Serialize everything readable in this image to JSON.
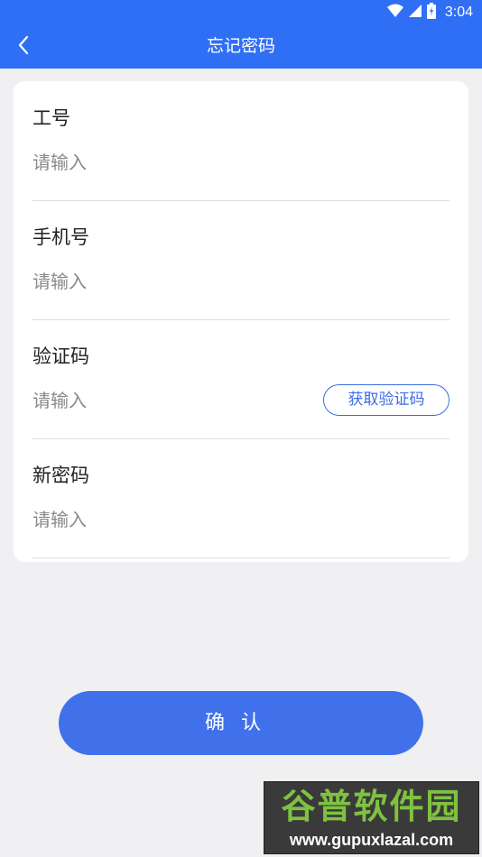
{
  "status_bar": {
    "time": "3:04",
    "icons": [
      "wifi-icon",
      "signal-icon",
      "battery-icon"
    ],
    "background": "#2f6ff5"
  },
  "app_bar": {
    "title": "忘记密码",
    "back_icon": "chevron-left-icon"
  },
  "form": {
    "fields": [
      {
        "label": "工号",
        "placeholder": "请输入",
        "value": ""
      },
      {
        "label": "手机号",
        "placeholder": "请输入",
        "value": ""
      },
      {
        "label": "验证码",
        "placeholder": "请输入",
        "value": ""
      },
      {
        "label": "新密码",
        "placeholder": "请输入",
        "value": ""
      }
    ],
    "get_code_label": "获取验证码"
  },
  "confirm_label": "确认",
  "watermark": {
    "title": "谷普软件园",
    "url": "www.gupuxlazal.com"
  },
  "colors": {
    "primary": "#2f6ff5",
    "button": "#4071eb",
    "background": "#f0f0f2"
  }
}
